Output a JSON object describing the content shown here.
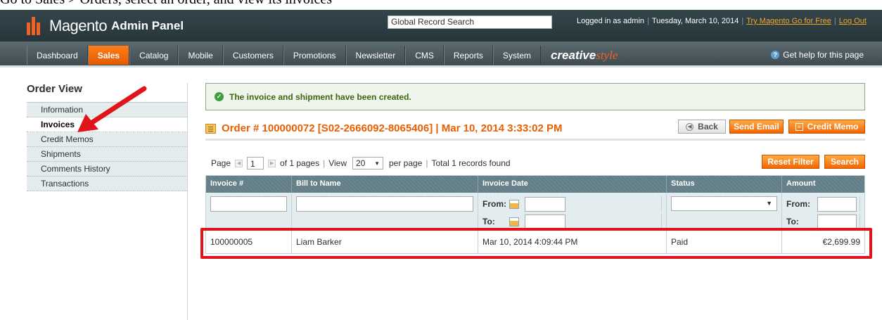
{
  "caption": "Go to Sales > Orders, select an order, and view its invoices",
  "header": {
    "logo_text": "Magento",
    "logo_sub": "Admin Panel",
    "search_value": "Global Record Search",
    "logged_in": "Logged in as admin",
    "date": "Tuesday, March 10, 2014",
    "try_link": "Try Magento Go for Free",
    "logout_link": "Log Out"
  },
  "nav": {
    "items": [
      "Dashboard",
      "Sales",
      "Catalog",
      "Mobile",
      "Customers",
      "Promotions",
      "Newsletter",
      "CMS",
      "Reports",
      "System"
    ],
    "brand_a": "creative",
    "brand_b": "style",
    "help": "Get help for this page"
  },
  "sidebar": {
    "title": "Order View",
    "tabs": [
      "Information",
      "Invoices",
      "Credit Memos",
      "Shipments",
      "Comments History",
      "Transactions"
    ]
  },
  "message": "The invoice and shipment have been created.",
  "order_title": "Order # 100000072 [S02-2666092-8065406] | Mar 10, 2014 3:33:02 PM",
  "buttons": {
    "back": "Back",
    "send_email": "Send Email",
    "credit_memo": "Credit Memo",
    "reset_filter": "Reset Filter",
    "search": "Search"
  },
  "pager": {
    "page_label": "Page",
    "page_value": "1",
    "of_pages": "of 1 pages",
    "view_label": "View",
    "view_value": "20",
    "per_page": "per page",
    "total": "Total 1 records found"
  },
  "grid": {
    "columns": [
      "Invoice #",
      "Bill to Name",
      "Invoice Date",
      "Status",
      "Amount"
    ],
    "from_label": "From:",
    "to_label": "To:",
    "rows": [
      {
        "invoice": "100000005",
        "bill_to": "Liam Barker",
        "date": "Mar 10, 2014 4:09:44 PM",
        "status": "Paid",
        "amount": "€2,699.99"
      }
    ]
  },
  "colors": {
    "accent": "#f26322",
    "header_bg": "#2e3e44",
    "highlight": "#e2141b"
  }
}
